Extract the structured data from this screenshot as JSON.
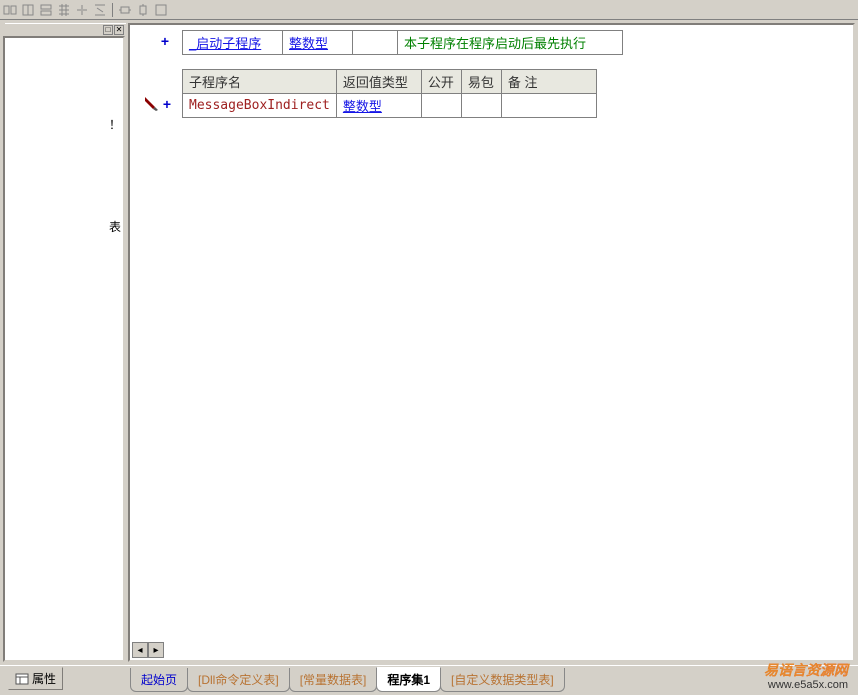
{
  "toolbar": {
    "icons": [
      "btn1",
      "btn2",
      "btn3",
      "btn4",
      "btn5",
      "btn6",
      "btn7",
      "btn8",
      "btn9",
      "btn10"
    ]
  },
  "table1": {
    "row": {
      "name": "_启动子程序",
      "type": "整数型",
      "c1": "",
      "comment": "本子程序在程序启动后最先执行"
    }
  },
  "table2": {
    "headers": {
      "name": "子程序名",
      "type": "返回值类型",
      "public": "公开",
      "pkg": "易包",
      "note": "备 注"
    },
    "row": {
      "name": "MessageBoxIndirect",
      "type": "整数型",
      "public": "",
      "pkg": "",
      "note": ""
    }
  },
  "sidebar": {
    "char1": "！",
    "char2": "表"
  },
  "properties_label": "属性",
  "tabs": {
    "start": "起始页",
    "dll": "[Dll命令定义表]",
    "const": "[常量数据表]",
    "prog": "程序集1",
    "custom": "[自定义数据类型表]"
  },
  "watermark": {
    "cn": "易语言资源网",
    "url": "www.e5a5x.com"
  }
}
